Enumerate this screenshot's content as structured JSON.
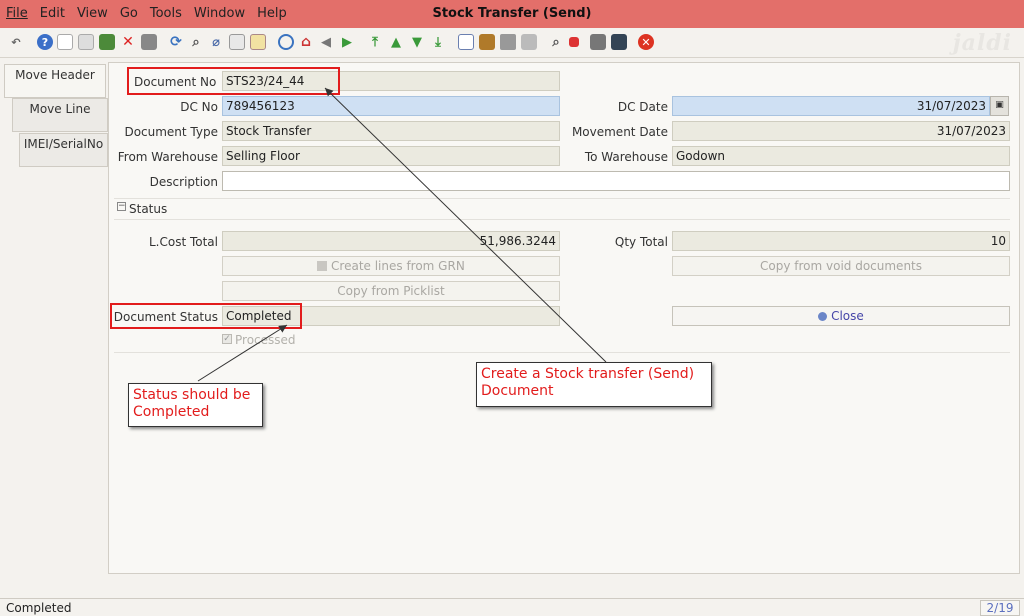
{
  "window": {
    "title": "Stock Transfer (Send)",
    "logo": "jaldi"
  },
  "menu": [
    "File",
    "Edit",
    "View",
    "Go",
    "Tools",
    "Window",
    "Help"
  ],
  "toolbar_icons": [
    "undo-icon",
    "help-icon",
    "new-icon",
    "copy-icon",
    "save-icon",
    "delete-icon",
    "disk-icon",
    "refresh-icon",
    "find-icon",
    "attachment-icon",
    "chat-icon",
    "zoom-icon",
    "history-icon",
    "home-icon",
    "back-icon",
    "forward-icon",
    "first-icon",
    "previous-icon",
    "next-icon",
    "last-icon",
    "report-icon",
    "archive-icon",
    "print-icon",
    "print-preview-icon",
    "zoom-across-icon",
    "workflow-icon",
    "request-icon",
    "product-info-icon",
    "close-window-icon"
  ],
  "tabs": [
    "Move Header",
    "Move Line",
    "IMEI/SerialNo"
  ],
  "form": {
    "document_no": {
      "label": "Document No",
      "value": "STS23/24_44"
    },
    "dc_no": {
      "label": "DC No",
      "value": "789456123"
    },
    "dc_date": {
      "label": "DC Date",
      "value": "31/07/2023"
    },
    "document_type": {
      "label": "Document Type",
      "value": "Stock Transfer"
    },
    "movement_date": {
      "label": "Movement Date",
      "value": "31/07/2023"
    },
    "from_warehouse": {
      "label": "From Warehouse",
      "value": "Selling Floor"
    },
    "to_warehouse": {
      "label": "To Warehouse",
      "value": "Godown"
    },
    "description": {
      "label": "Description",
      "value": ""
    }
  },
  "status_section": {
    "header": "Status",
    "lcost_total": {
      "label": "L.Cost Total",
      "value": "51,986.3244"
    },
    "qty_total": {
      "label": "Qty Total",
      "value": "10"
    },
    "create_lines_button": "Create lines from GRN",
    "copy_void_button": "Copy from void documents",
    "copy_picklist_button": "Copy from Picklist",
    "document_status": {
      "label": "Document Status",
      "value": "Completed"
    },
    "close_button": "Close",
    "processed_label": "Processed"
  },
  "annotations": {
    "status_note": "Status should be Completed",
    "create_note": "Create a Stock transfer (Send) Document"
  },
  "statusbar": {
    "text": "Completed",
    "page": "2/19"
  },
  "colors": {
    "titlebar": "#e36f6a",
    "annotation": "#e21c1c",
    "dc_field": "#cfe0f3"
  }
}
